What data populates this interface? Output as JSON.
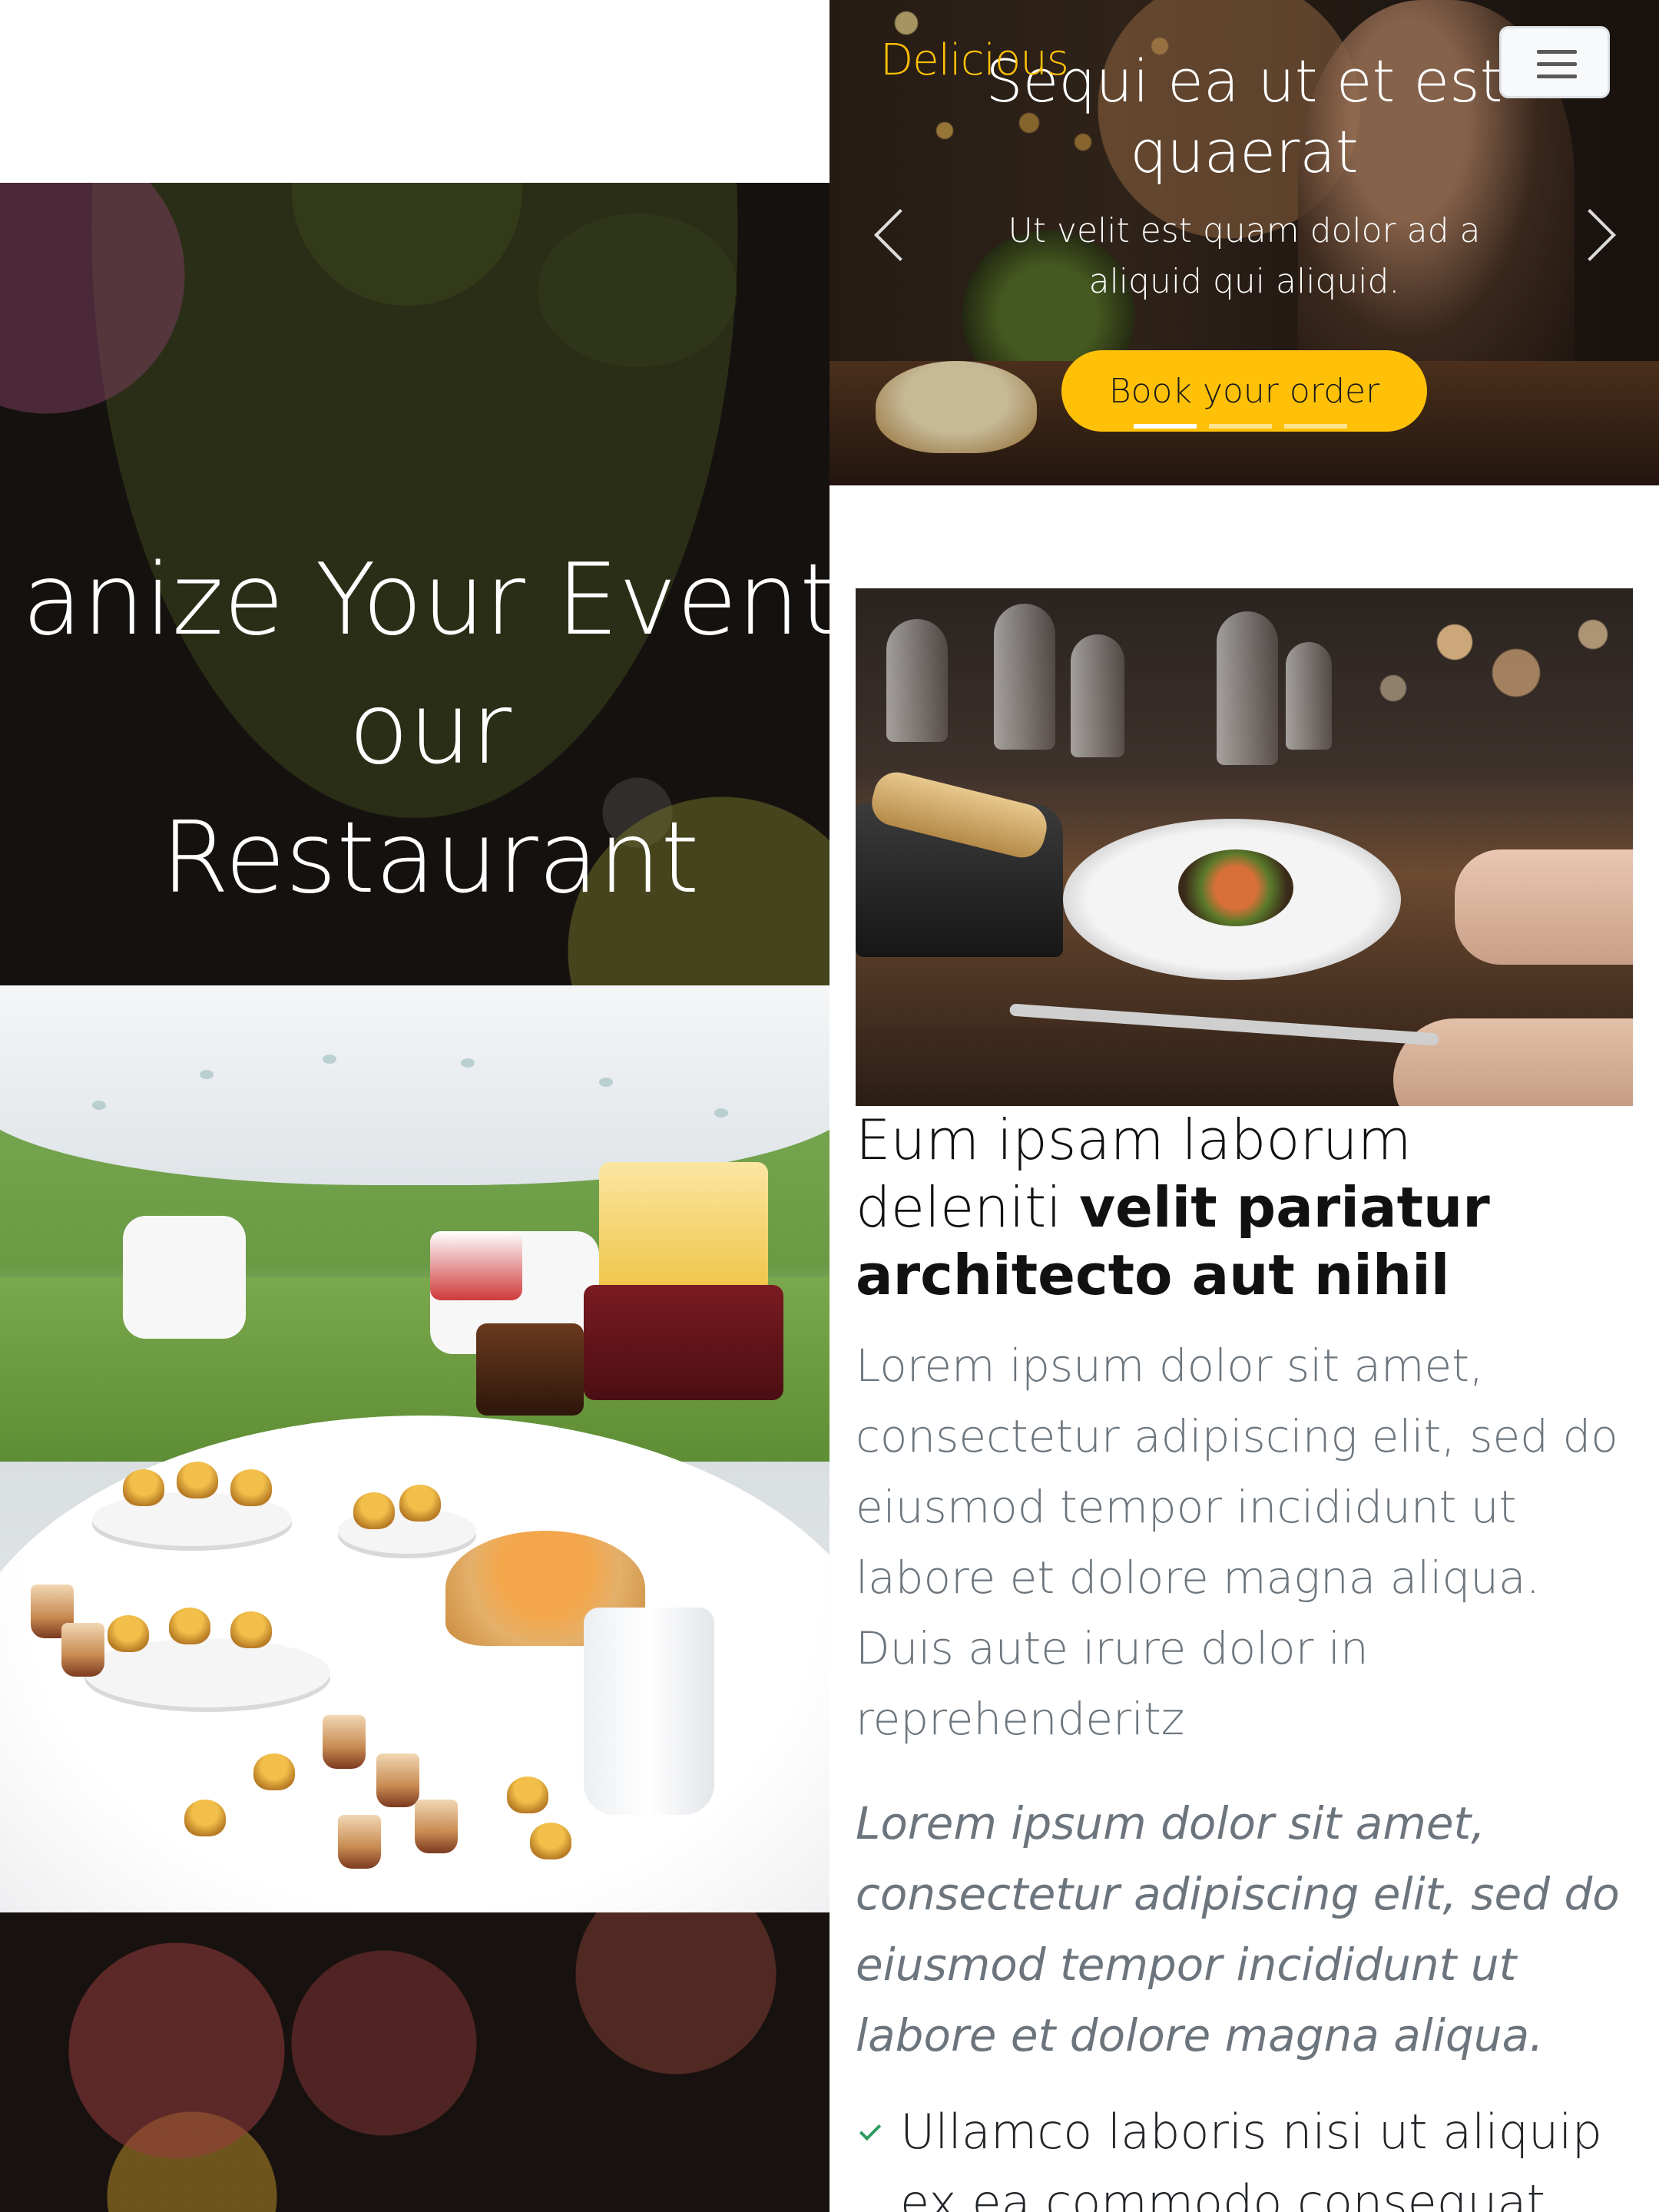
{
  "left_panel": {
    "event_title_lines": [
      "anize Your Event",
      "our",
      "Restaurant"
    ]
  },
  "navbar": {
    "brand": "Delicious",
    "menu_icon": "hamburger-icon"
  },
  "hero": {
    "title": "Sequi ea ut et est quaerat",
    "subtitle": "Ut velit est quam dolor ad a aliquid qui aliquid.",
    "cta_label": "Book your order",
    "prev_icon": "chevron-left-icon",
    "next_icon": "chevron-right-icon",
    "slide_count": 3,
    "active_slide": 1
  },
  "about": {
    "heading_light": "Eum ipsam laborum deleniti ",
    "heading_bold": "velit pariatur architecto aut nihil",
    "paragraph": "Lorem ipsum dolor sit amet, consectetur adipiscing elit, sed do eiusmod tempor incididunt ut labore et dolore magna aliqua. Duis aute irure dolor in reprehenderitz",
    "italic": "Lorem ipsum dolor sit amet, consectetur adipiscing elit, sed do eiusmod tempor incididunt ut labore et dolore magna aliqua.",
    "list": [
      "Ullamco laboris nisi ut aliquip ex ea commodo consequat."
    ]
  },
  "colors": {
    "accent": "#ffc107",
    "check": "#2e9c60",
    "muted_text": "#6c757d"
  }
}
